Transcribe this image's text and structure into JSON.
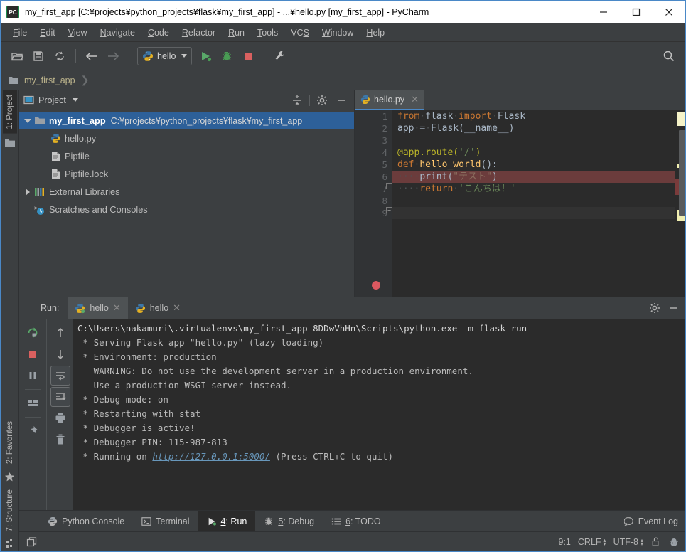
{
  "window": {
    "title": "my_first_app [C:¥projects¥python_projects¥flask¥my_first_app] - ...¥hello.py [my_first_app] - PyCharm",
    "app_icon_label": "PC",
    "minimize": "—",
    "maximize": "❐",
    "close": "✕"
  },
  "menubar": {
    "items": [
      {
        "label": "File",
        "mnemonic": "F"
      },
      {
        "label": "Edit",
        "mnemonic": "E"
      },
      {
        "label": "View",
        "mnemonic": "V"
      },
      {
        "label": "Navigate",
        "mnemonic": "N"
      },
      {
        "label": "Code",
        "mnemonic": "C"
      },
      {
        "label": "Refactor",
        "mnemonic": "R"
      },
      {
        "label": "Run",
        "mnemonic": "R"
      },
      {
        "label": "Tools",
        "mnemonic": "T"
      },
      {
        "label": "VCS",
        "mnemonic": "S"
      },
      {
        "label": "Window",
        "mnemonic": "W"
      },
      {
        "label": "Help",
        "mnemonic": "H"
      }
    ]
  },
  "toolbar": {
    "open_label": "Open",
    "save_label": "Save All",
    "sync_label": "Synchronize",
    "back_label": "Back",
    "forward_label": "Forward",
    "run_config_name": "hello",
    "run_label": "Run",
    "debug_label": "Debug",
    "stop_label": "Stop",
    "settings_label": "Settings",
    "search_label": "Search Everywhere"
  },
  "breadcrumb": {
    "items": [
      "my_first_app"
    ]
  },
  "left_stripe": {
    "top": [
      {
        "label": "1: Project",
        "mnemonic": "1",
        "active": true
      }
    ],
    "bottom": [
      {
        "label": "2: Favorites",
        "mnemonic": "2",
        "active": false
      },
      {
        "label": "7: Structure",
        "mnemonic": "7",
        "active": false
      }
    ]
  },
  "project_panel": {
    "title": "Project",
    "collapse_all_label": "Collapse All",
    "settings_label": "Settings",
    "hide_label": "Hide",
    "tree": [
      {
        "name": "my_first_app",
        "path": "C:¥projects¥python_projects¥flask¥my_first_app",
        "icon": "folder-icon",
        "expanded": true,
        "selected": true,
        "depth": 0
      },
      {
        "name": "hello.py",
        "path": "",
        "icon": "python-file-icon",
        "expanded": null,
        "selected": false,
        "depth": 1
      },
      {
        "name": "Pipfile",
        "path": "",
        "icon": "text-file-icon",
        "expanded": null,
        "selected": false,
        "depth": 1
      },
      {
        "name": "Pipfile.lock",
        "path": "",
        "icon": "text-file-icon",
        "expanded": null,
        "selected": false,
        "depth": 1
      },
      {
        "name": "External Libraries",
        "path": "",
        "icon": "libraries-icon",
        "expanded": false,
        "selected": false,
        "depth": 0
      },
      {
        "name": "Scratches and Consoles",
        "path": "",
        "icon": "scratches-icon",
        "expanded": null,
        "selected": false,
        "depth": 0
      }
    ]
  },
  "editor": {
    "tabs": [
      {
        "label": "hello.py",
        "icon": "python-file-icon",
        "active": true,
        "close": "✕"
      }
    ],
    "line_numbers": [
      "1",
      "2",
      "3",
      "4",
      "5",
      "6",
      "7",
      "8",
      "9"
    ],
    "lines": [
      {
        "n": 1,
        "text": "from flask import Flask"
      },
      {
        "n": 2,
        "text": "app = Flask(__name__)"
      },
      {
        "n": 3,
        "text": ""
      },
      {
        "n": 4,
        "text": "@app.route('/')"
      },
      {
        "n": 5,
        "text": "def hello_world():"
      },
      {
        "n": 6,
        "text": "    print(\"テスト\")"
      },
      {
        "n": 7,
        "text": "    return 'こんちは！'"
      },
      {
        "n": 8,
        "text": ""
      },
      {
        "n": 9,
        "text": ""
      }
    ],
    "breakpoint_line": 6,
    "current_line": 9
  },
  "run_panel": {
    "label": "Run:",
    "tabs": [
      {
        "label": "hello",
        "icon": "python-run-icon",
        "active": true,
        "close": "✕"
      },
      {
        "label": "hello",
        "icon": "python-run-icon",
        "active": false,
        "close": "✕"
      }
    ],
    "settings_label": "Settings",
    "hide_label": "Hide",
    "tools_col1": [
      "rerun-icon",
      "stop-icon",
      "pause-icon",
      "layout-icon",
      "pin-icon"
    ],
    "tools_col2": [
      "up-arrow-icon",
      "down-arrow-icon",
      "soft-wrap-icon",
      "scroll-to-end-icon",
      "print-icon",
      "trash-icon"
    ],
    "console_lines": [
      {
        "text": "C:\\Users\\nakamuri\\.virtualenvs\\my_first_app-8DDwVhHn\\Scripts\\python.exe -m flask run",
        "style": "white"
      },
      {
        "text": " * Serving Flask app \"hello.py\" (lazy loading)",
        "style": "gray"
      },
      {
        "text": " * Environment: production",
        "style": "gray"
      },
      {
        "text": "   WARNING: Do not use the development server in a production environment.",
        "style": "gray"
      },
      {
        "text": "   Use a production WSGI server instead.",
        "style": "gray"
      },
      {
        "text": " * Debug mode: on",
        "style": "gray"
      },
      {
        "text": " * Restarting with stat",
        "style": "gray"
      },
      {
        "text": " * Debugger is active!",
        "style": "gray"
      },
      {
        "text": " * Debugger PIN: 115-987-813",
        "style": "gray"
      },
      {
        "text": " * Running on ",
        "style": "gray",
        "link": "http://127.0.0.1:5000/",
        "after": " (Press CTRL+C to quit)"
      }
    ]
  },
  "bottom_bar": {
    "items": [
      {
        "label": "Python Console",
        "icon": "python-console-icon",
        "mnemonic": "",
        "active": false
      },
      {
        "label": "Terminal",
        "icon": "terminal-icon",
        "mnemonic": "",
        "active": false
      },
      {
        "label": "4: Run",
        "icon": "run-icon",
        "mnemonic": "4",
        "active": true
      },
      {
        "label": "5: Debug",
        "icon": "debug-icon",
        "mnemonic": "5",
        "active": false
      },
      {
        "label": "6: TODO",
        "icon": "todo-icon",
        "mnemonic": "6",
        "active": false
      }
    ],
    "event_log": "Event Log"
  },
  "status_bar": {
    "caret_position": "9:1",
    "line_separator": "CRLF",
    "encoding": "UTF-8",
    "lock_label": "unlocked",
    "git_branch_icon": "hector-icon"
  },
  "colors": {
    "accent_blue": "#4a88c7",
    "bg_panel": "#3c3f41",
    "bg_editor": "#2b2b2b",
    "selection_blue": "#2d6099",
    "breakpoint_red": "#db5860",
    "keyword_orange": "#cc7832",
    "string_green": "#6a8759",
    "function_yellow": "#ffc66d",
    "decorator_yellow": "#bbb529",
    "plain_text": "#a9b7c6"
  }
}
